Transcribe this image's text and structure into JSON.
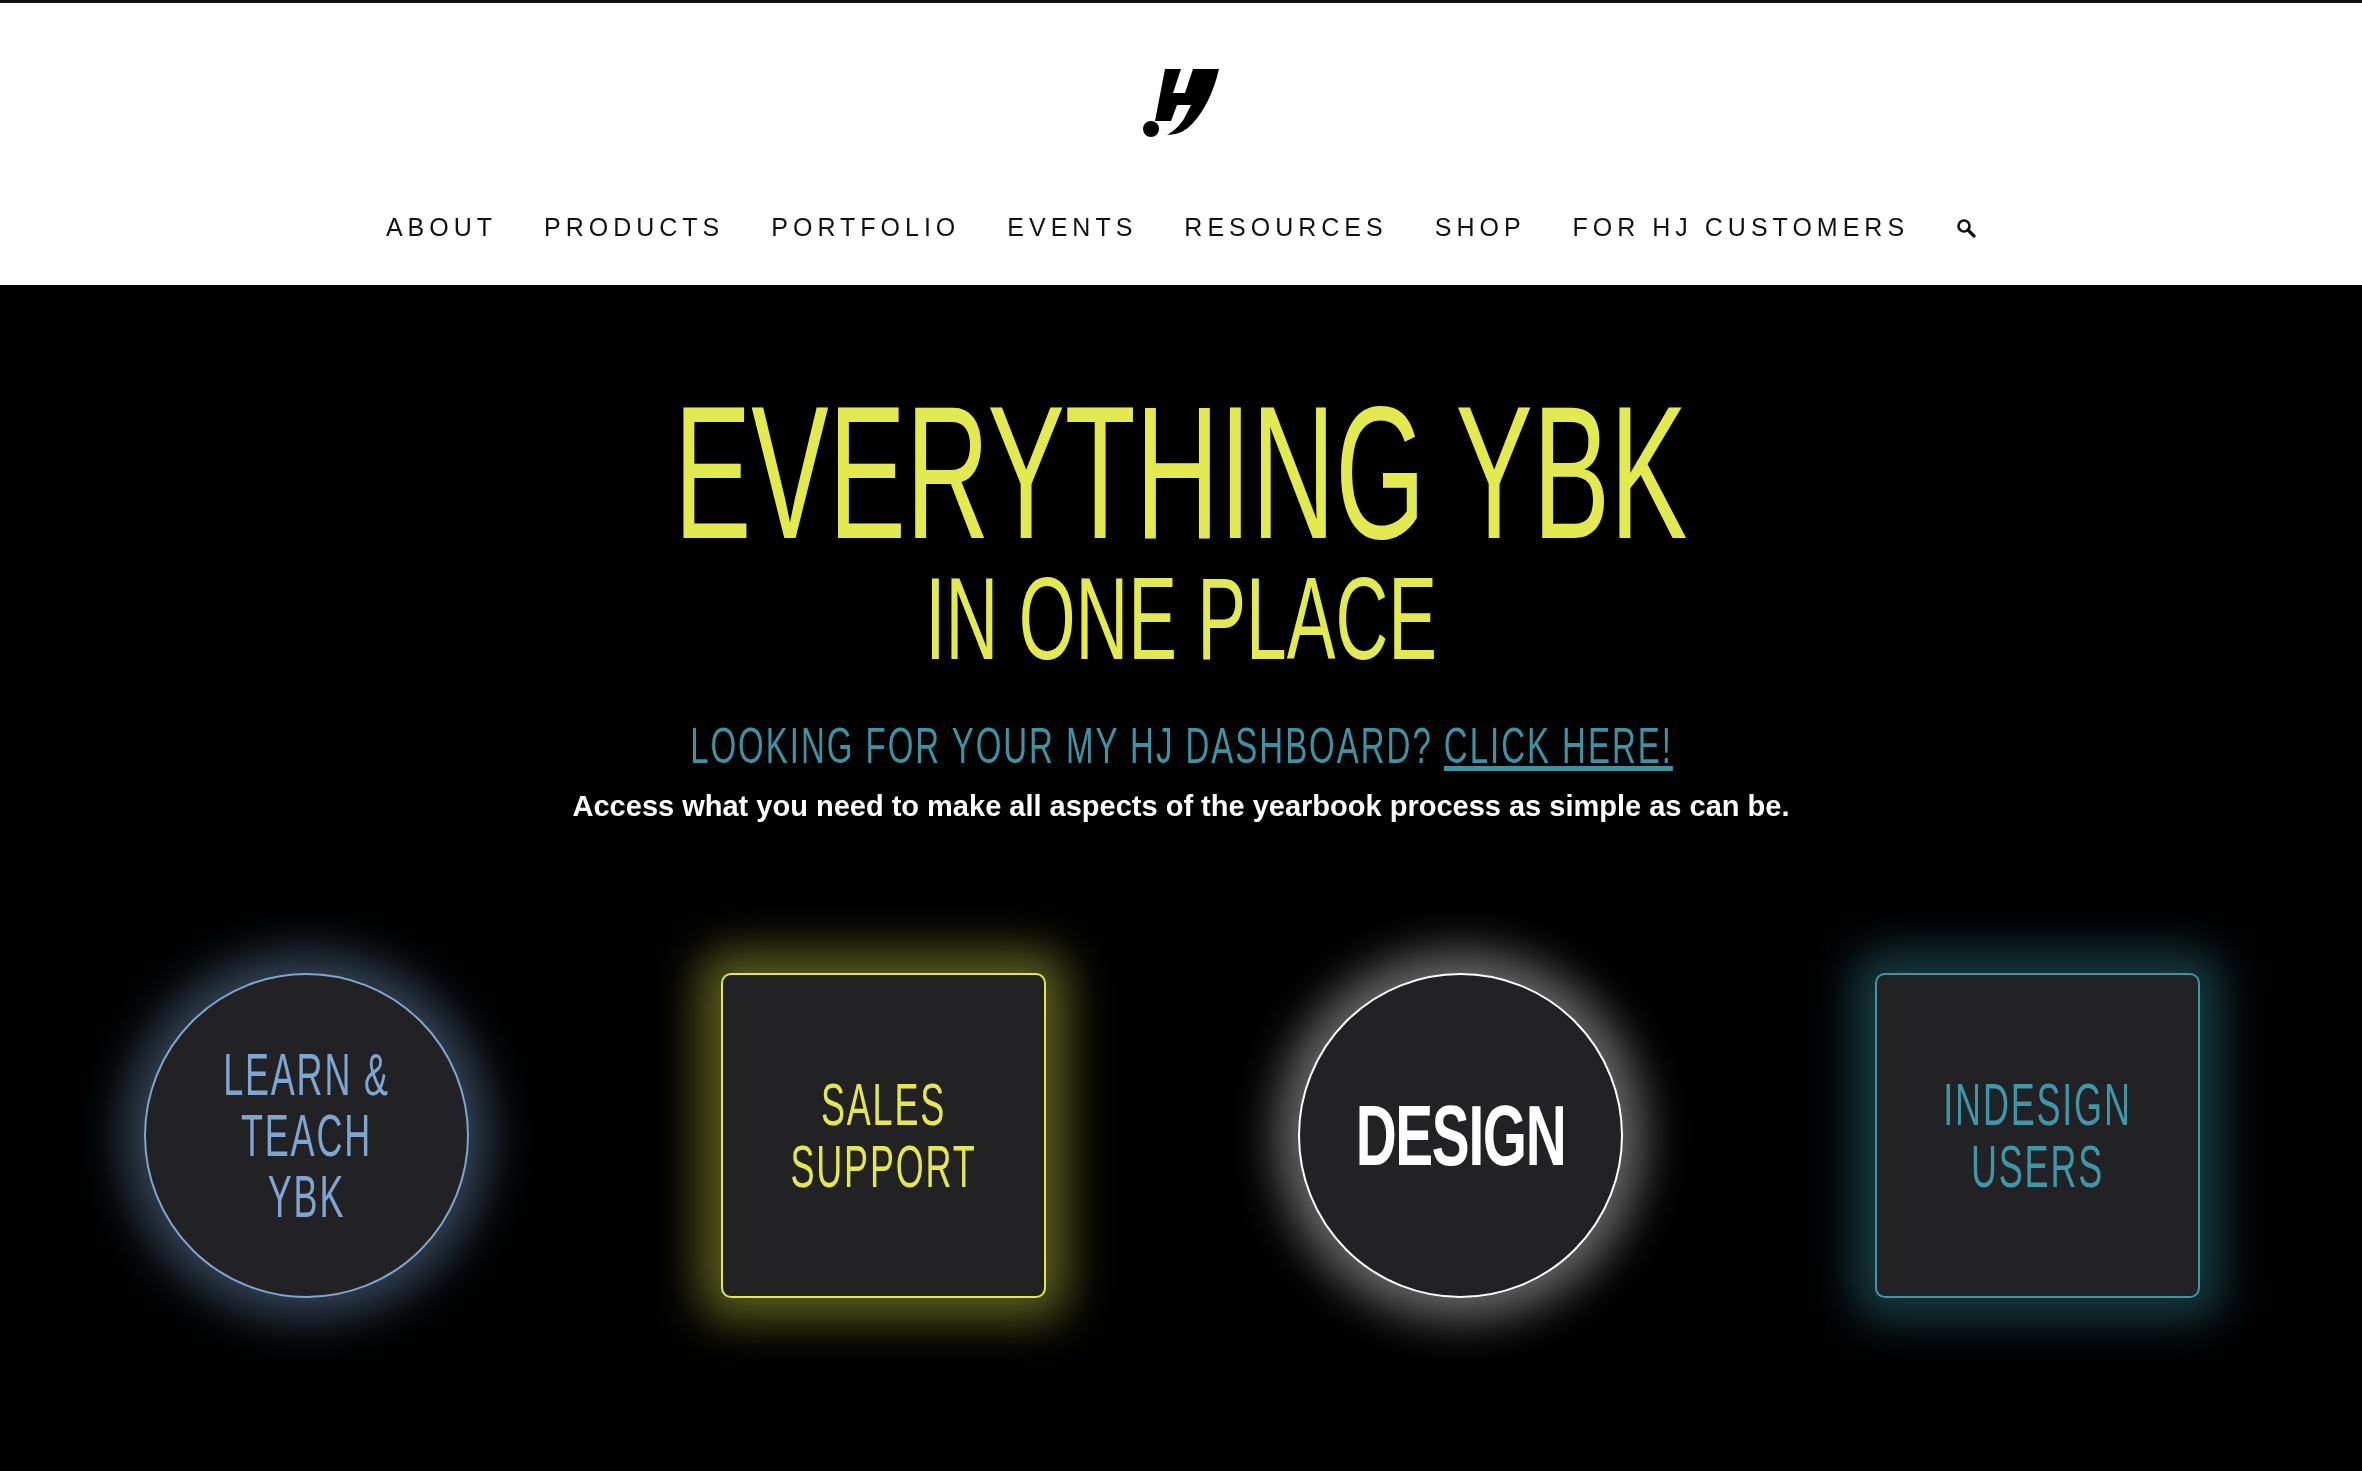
{
  "header": {
    "nav": [
      {
        "label": "ABOUT"
      },
      {
        "label": "PRODUCTS"
      },
      {
        "label": "PORTFOLIO"
      },
      {
        "label": "EVENTS"
      },
      {
        "label": "RESOURCES"
      },
      {
        "label": "SHOP"
      },
      {
        "label": "FOR HJ CUSTOMERS"
      }
    ]
  },
  "hero": {
    "title": "EVERYTHING YBK",
    "subtitle": "IN ONE PLACE",
    "prompt": "LOOKING FOR YOUR MY HJ DASHBOARD?",
    "prompt_link": "CLICK HERE!",
    "description": "Access what you need to make all aspects of the yearbook process as simple as can be."
  },
  "cards": [
    {
      "label": "LEARN & TEACH YBK",
      "kind": "circle",
      "color": "#7ea6d2"
    },
    {
      "label": "SALES SUPPORT",
      "kind": "square",
      "color": "#e2e84e"
    },
    {
      "label": "DESIGN",
      "kind": "circle",
      "color": "#ffffff"
    },
    {
      "label": "INDESIGN USERS",
      "kind": "square",
      "color": "#3d97a8"
    }
  ]
}
